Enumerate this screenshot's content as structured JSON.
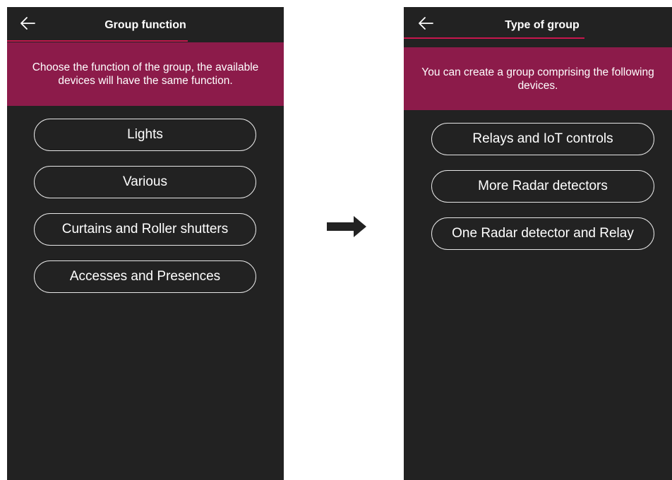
{
  "left_screen": {
    "title": "Group function",
    "back_icon": "arrow-left-icon",
    "description": "Choose the function of the group, the available devices will have the same function.",
    "options": [
      "Lights",
      "Various",
      "Curtains and Roller shutters",
      "Accesses and Presences"
    ]
  },
  "right_screen": {
    "title": "Type of group",
    "back_icon": "arrow-left-icon",
    "description": "You can create a group comprising the following devices.",
    "options": [
      "Relays and IoT controls",
      "More Radar detectors",
      "One Radar detector and Relay"
    ]
  },
  "transition_icon": "arrow-right-icon",
  "colors": {
    "screen_background": "#222222",
    "banner": "#8c1b4a",
    "accent_underline": "#c8174e",
    "text": "#ffffff",
    "button_border": "#e6e6e6"
  }
}
